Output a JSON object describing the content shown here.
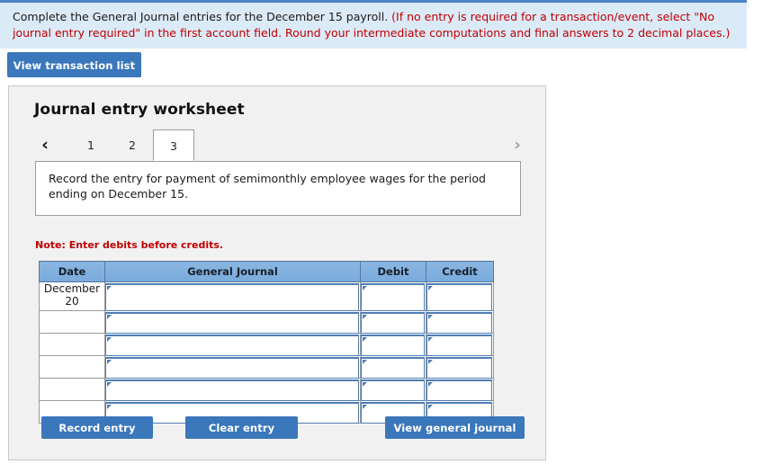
{
  "banner": {
    "main_text": "Complete the General Journal entries for the December 15 payroll. ",
    "note_text": "(If no entry is required for a transaction/event, select \"No journal entry required\" in the first account field. Round your intermediate computations and final answers to 2 decimal places.)",
    "background_color": "#dbeaf7",
    "note_color": "#c00000",
    "top_border_color": "#4a87c4"
  },
  "toolbar": {
    "view_transaction_list_label": "View transaction list"
  },
  "panel": {
    "title": "Journal entry worksheet",
    "nav": {
      "prev_icon": "‹",
      "next_icon": "›",
      "prev_enabled": "true",
      "next_enabled": "false"
    },
    "tabs": [
      {
        "label": "1",
        "active": "false"
      },
      {
        "label": "2",
        "active": "false"
      },
      {
        "label": "3",
        "active": "true"
      }
    ],
    "prompt": "Record the entry for payment of semimonthly employee wages for the period ending on December 15.",
    "note": "Note: Enter debits before credits."
  },
  "table": {
    "columns": [
      "Date",
      "General Journal",
      "Debit",
      "Credit"
    ],
    "header_color": "#82b1de",
    "rows": [
      {
        "date": "December 20",
        "general_journal": "",
        "debit": "",
        "credit": ""
      },
      {
        "date": "",
        "general_journal": "",
        "debit": "",
        "credit": ""
      },
      {
        "date": "",
        "general_journal": "",
        "debit": "",
        "credit": ""
      },
      {
        "date": "",
        "general_journal": "",
        "debit": "",
        "credit": ""
      },
      {
        "date": "",
        "general_journal": "",
        "debit": "",
        "credit": ""
      },
      {
        "date": "",
        "general_journal": "",
        "debit": "",
        "credit": ""
      }
    ]
  },
  "actions": {
    "record_entry_label": "Record entry",
    "clear_entry_label": "Clear entry",
    "view_general_journal_label": "View general journal",
    "button_color": "#3a77bb"
  }
}
